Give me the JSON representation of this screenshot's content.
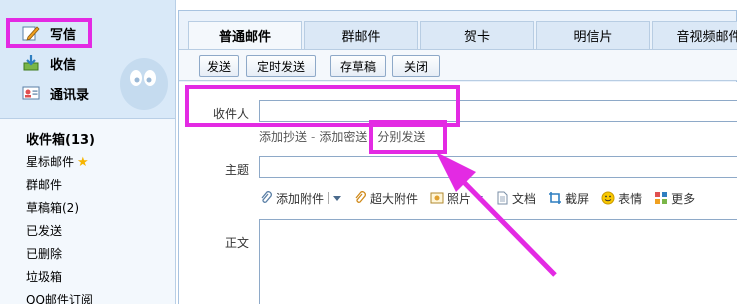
{
  "sidebar": {
    "write_label": "写信",
    "inbox_label": "收信",
    "contacts_label": "通讯录",
    "folders": [
      {
        "label": "收件箱(13)",
        "bold": true
      },
      {
        "label": "星标邮件",
        "star": true
      },
      {
        "label": "群邮件"
      },
      {
        "label": "草稿箱(2)"
      },
      {
        "label": "已发送"
      },
      {
        "label": "已删除"
      },
      {
        "label": "垃圾箱"
      },
      {
        "label": "QQ邮件订阅"
      }
    ]
  },
  "tabs": [
    "普通邮件",
    "群邮件",
    "贺卡",
    "明信片",
    "音视频邮件"
  ],
  "toolbar": {
    "send_label": "发送",
    "scheduled_label": "定时发送",
    "draft_label": "存草稿",
    "close_label": "关闭"
  },
  "compose": {
    "recipient_label": "收件人",
    "recipient_value": "",
    "add_cc_label": "添加抄送",
    "link_separator": "-",
    "add_bcc_label": "添加密送",
    "separate_send_label": "分别发送",
    "subject_label": "主题",
    "subject_value": "",
    "body_label": "正文"
  },
  "attach_bar": {
    "add_attachment": "添加附件",
    "large_attachment": "超大附件",
    "photo": "照片",
    "document": "文档",
    "screenshot": "截屏",
    "emoji": "表情",
    "more": "更多"
  },
  "colors": {
    "highlight": "#e32ae3",
    "sidebar_bg": "#d9e9f8",
    "tab_active_bg": "#f4f8fc",
    "border": "#a8c3e0"
  },
  "icons": [
    "pencil-write-icon",
    "inbox-download-icon",
    "contacts-card-icon",
    "star-icon",
    "paperclip-icon",
    "photo-icon",
    "document-icon",
    "screenshot-icon",
    "smiley-icon",
    "grid-more-icon"
  ]
}
